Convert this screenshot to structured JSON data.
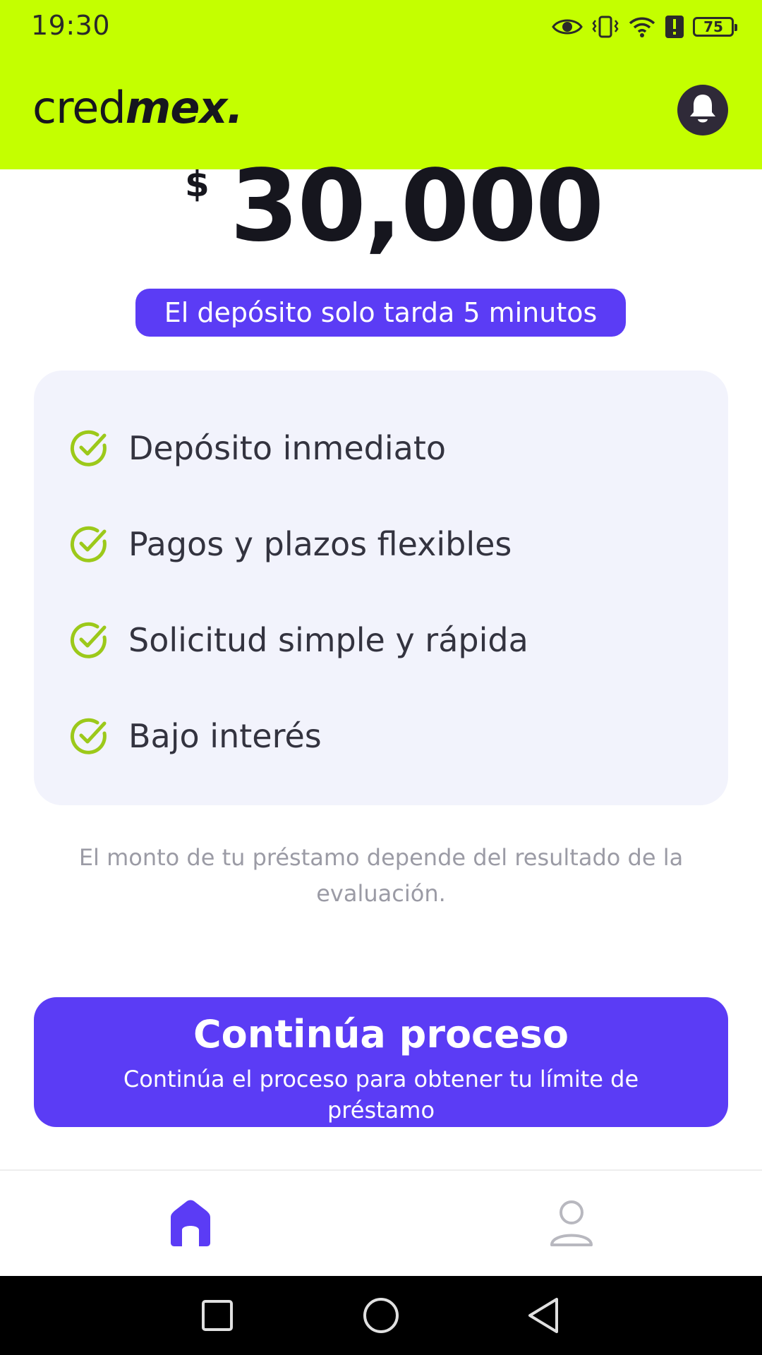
{
  "status_bar": {
    "time": "19:30",
    "battery": "75",
    "icons": [
      "eye-icon",
      "vibrate-icon",
      "wifi-icon",
      "alert-icon",
      "battery-icon"
    ]
  },
  "header": {
    "logo_light": "cred",
    "logo_bold": "mex.",
    "notification_icon": "bell-icon",
    "background_color": "#c4ff00"
  },
  "loan": {
    "currency": "$",
    "amount": "30,000",
    "deposit_note": "El depósito solo tarda 5 minutos"
  },
  "features": {
    "items": [
      {
        "label": "Depósito inmediato",
        "icon": "check-circle-icon"
      },
      {
        "label": "Pagos y plazos flexibles",
        "icon": "check-circle-icon"
      },
      {
        "label": "Solicitud simple y rápida",
        "icon": "check-circle-icon"
      },
      {
        "label": "Bajo interés",
        "icon": "check-circle-icon"
      }
    ],
    "check_color": "#9cc91a"
  },
  "disclaimer": "El monto de tu préstamo depende del resultado de la evaluación.",
  "cta": {
    "title": "Continúa proceso",
    "subtitle": "Continúa el proceso para obtener tu límite de préstamo",
    "color": "#5b3cf5"
  },
  "bottom_nav": {
    "items": [
      {
        "icon": "home-icon",
        "active": true
      },
      {
        "icon": "profile-icon",
        "active": false
      }
    ],
    "active_color": "#5b3cf5"
  },
  "system_nav": {
    "buttons": [
      "recents-icon",
      "home-circle-icon",
      "back-icon"
    ]
  }
}
